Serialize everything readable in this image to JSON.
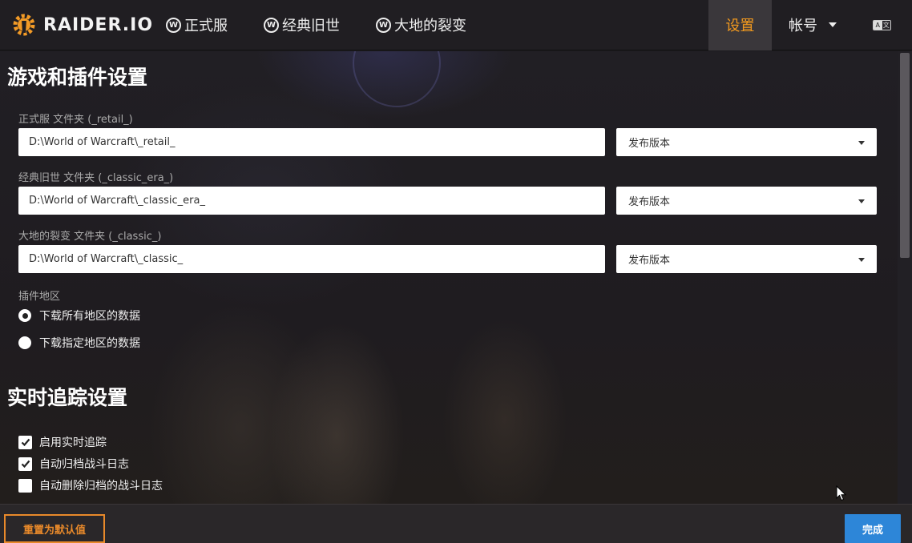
{
  "app": {
    "logo_text": "RAIDER.IO"
  },
  "nav": {
    "items": [
      {
        "icon": "W",
        "label": "正式服"
      },
      {
        "icon": "W",
        "label": "经典旧世"
      },
      {
        "icon": "W",
        "label": "大地的裂变"
      }
    ],
    "settings_label": "设置",
    "account_label": "帐号",
    "lang_icon": {
      "left": "A",
      "right": "文"
    }
  },
  "game_settings": {
    "title": "游戏和插件设置",
    "folders": [
      {
        "label": "正式服 文件夹 (_retail_)",
        "path": "D:\\World of Warcraft\\_retail_",
        "release": "发布版本"
      },
      {
        "label": "经典旧世 文件夹 (_classic_era_)",
        "path": "D:\\World of Warcraft\\_classic_era_",
        "release": "发布版本"
      },
      {
        "label": "大地的裂变 文件夹 (_classic_)",
        "path": "D:\\World of Warcraft\\_classic_",
        "release": "发布版本"
      }
    ],
    "region_label": "插件地区",
    "region_options": [
      {
        "label": "下载所有地区的数据",
        "selected": true
      },
      {
        "label": "下载指定地区的数据",
        "selected": false
      }
    ]
  },
  "live_tracking": {
    "title": "实时追踪设置",
    "options": [
      {
        "label": "启用实时追踪",
        "checked": true
      },
      {
        "label": "自动归档战斗日志",
        "checked": true
      },
      {
        "label": "自动删除归档的战斗日志",
        "checked": false
      }
    ]
  },
  "footer": {
    "reset_label": "重置为默认值",
    "done_label": "完成"
  },
  "colors": {
    "accent_orange": "#f39a1e",
    "done_blue": "#2d86d8"
  }
}
